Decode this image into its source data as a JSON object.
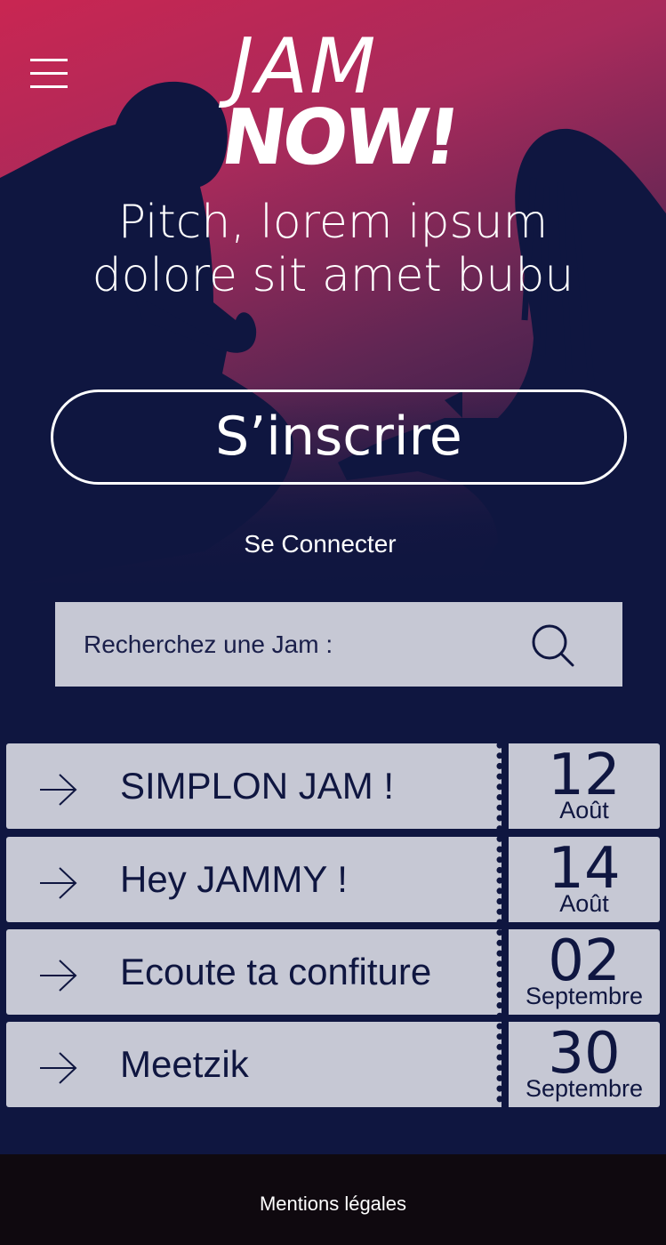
{
  "header": {
    "logo_top": "JAM",
    "logo_bottom": "NOW!"
  },
  "hero": {
    "pitch_line1": "Pitch, lorem ipsum",
    "pitch_line2": "dolore sit amet bubu",
    "signup_label": "S’inscrire",
    "login_label": "Se Connecter"
  },
  "search": {
    "label": "Recherchez une Jam :",
    "icon": "search-icon"
  },
  "jams": [
    {
      "title": "SIMPLON JAM !",
      "day": "12",
      "month": "Août"
    },
    {
      "title": "Hey JAMMY !",
      "day": "14",
      "month": "Août"
    },
    {
      "title": "Ecoute ta confiture",
      "day": "02",
      "month": "Septembre"
    },
    {
      "title": "Meetzik",
      "day": "30",
      "month": "Septembre"
    }
  ],
  "footer": {
    "legal_label": "Mentions légales"
  },
  "colors": {
    "navy": "#0f1640",
    "accent_pink": "#c92652",
    "card": "#c6c8d4",
    "footer": "#0f090f"
  }
}
